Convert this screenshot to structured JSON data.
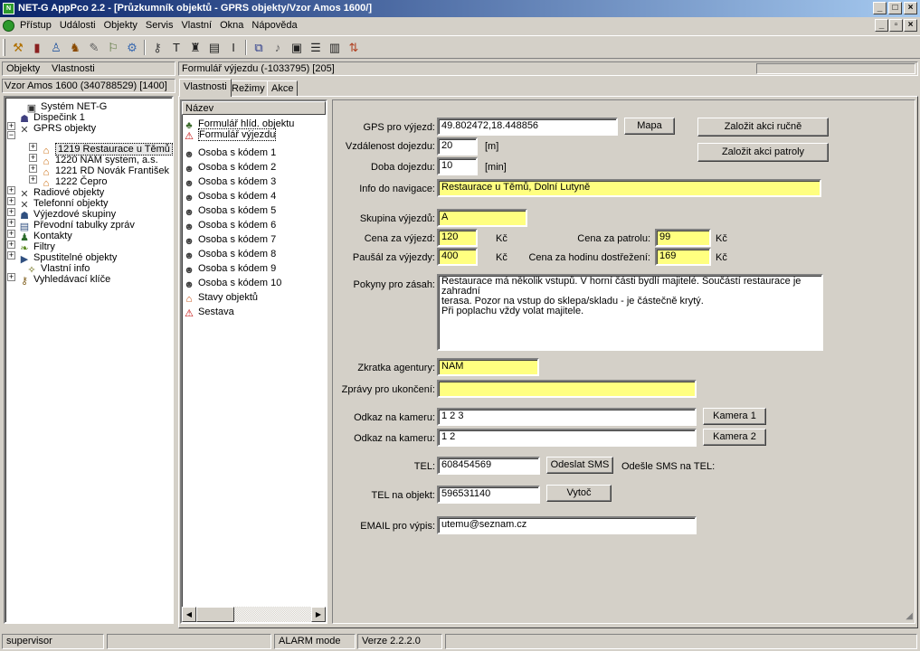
{
  "window": {
    "title": "NET-G AppPco 2.2 - [Průzkumník objektů - GPRS objekty/Vzor Amos 1600/]"
  },
  "menu": [
    "Přístup",
    "Události",
    "Objekty",
    "Servis",
    "Vlastní",
    "Okna",
    "Nápověda"
  ],
  "left_panel": {
    "tabs": [
      "Objekty",
      "Vlastnosti"
    ],
    "path": "Vzor Amos 1600  (340788529) [1400]",
    "tree": [
      {
        "label": "Systém NET-G",
        "icon": "computer-icon"
      },
      {
        "label": "Dispečink 1",
        "icon": "network-icon"
      },
      {
        "label": "GPRS objekty",
        "icon": "antenna-icon"
      },
      {
        "label": "1219 Restaurace u Těmů",
        "icon": "house-icon"
      },
      {
        "label": "1220 NAM system, a.s.",
        "icon": "house-icon"
      },
      {
        "label": "1221 RD Novák František",
        "icon": "house-icon"
      },
      {
        "label": "1222 Čepro",
        "icon": "house-icon"
      },
      {
        "label": "Radiové objekty",
        "icon": "antenna-icon"
      },
      {
        "label": "Telefonní objekty",
        "icon": "antenna-icon"
      },
      {
        "label": "Výjezdové skupiny",
        "icon": "car-icon"
      },
      {
        "label": "Převodní tabulky zpráv",
        "icon": "table-icon"
      },
      {
        "label": "Kontakty",
        "icon": "person-icon"
      },
      {
        "label": "Filtry",
        "icon": "filter-icon"
      },
      {
        "label": "Spustitelné objekty",
        "icon": "run-icon"
      },
      {
        "label": "Vlastní info",
        "icon": "info-icon"
      },
      {
        "label": "Vyhledávací klíče",
        "icon": "key-icon"
      }
    ]
  },
  "middle_panel": {
    "header": "Formulář výjezdu  (-1033795) [205]",
    "tabs": [
      "Vlastnosti",
      "Režimy",
      "Akce"
    ],
    "list_header": "Název",
    "items": [
      {
        "label": "Formulář hlíd. objektu",
        "icon": "form-icon"
      },
      {
        "label": "Formulář výjezdu",
        "icon": "alert-icon"
      },
      {
        "label": "Osoba s kódem 1",
        "icon": "persons-icon"
      },
      {
        "label": "Osoba s kódem 2",
        "icon": "persons-icon"
      },
      {
        "label": "Osoba s kódem 3",
        "icon": "persons-icon"
      },
      {
        "label": "Osoba s kódem 4",
        "icon": "persons-icon"
      },
      {
        "label": "Osoba s kódem 5",
        "icon": "persons-icon"
      },
      {
        "label": "Osoba s kódem 6",
        "icon": "persons-icon"
      },
      {
        "label": "Osoba s kódem 7",
        "icon": "persons-icon"
      },
      {
        "label": "Osoba s kódem 8",
        "icon": "persons-icon"
      },
      {
        "label": "Osoba s kódem 9",
        "icon": "persons-icon"
      },
      {
        "label": "Osoba s kódem 10",
        "icon": "persons-icon"
      },
      {
        "label": "Stavy objektů",
        "icon": "state-icon"
      },
      {
        "label": "Sestava",
        "icon": "alert-icon"
      }
    ]
  },
  "form": {
    "gps": {
      "label": "GPS pro výjezd:",
      "value": "49.802472,18.448856",
      "button": "Mapa"
    },
    "distance": {
      "label": "Vzdálenost dojezdu:",
      "value": "20",
      "unit": "[m]"
    },
    "time": {
      "label": "Doba dojezdu:",
      "value": "10",
      "unit": "[min]"
    },
    "nav": {
      "label": "Info do navigace:",
      "value": "Restaurace u Těmů, Dolní Lutyně"
    },
    "group": {
      "label": "Skupina výjezdů:",
      "value": "A"
    },
    "price_trip": {
      "label": "Cena za výjezd:",
      "value": "120",
      "unit": "Kč"
    },
    "price_patrol": {
      "label": "Cena za patrolu:",
      "value": "99",
      "unit": "Kč"
    },
    "flat_fee": {
      "label": "Paušál za výjezdy:",
      "value": "400",
      "unit": "Kč"
    },
    "price_hour": {
      "label": "Cena za hodinu dostřežení:",
      "value": "169",
      "unit": "Kč"
    },
    "instructions": {
      "label": "Pokyny pro zásah:",
      "lines": [
        "Restaurace má několik vstupů. V horní části bydlí majitelé. Součástí restaurace je zahradní",
        "terasa. Pozor na vstup do sklepa/skladu - je částečně krytý.",
        "Při poplachu vždy volat majitele."
      ]
    },
    "agency": {
      "label": "Zkratka agentury:",
      "value": "NAM"
    },
    "end_msgs": {
      "label": "Zprávy pro ukončení:",
      "value": ""
    },
    "camera1": {
      "label": "Odkaz na kameru:",
      "value": "1 2 3",
      "button": "Kamera 1"
    },
    "camera2": {
      "label": "Odkaz na kameru:",
      "value": "1 2",
      "button": "Kamera 2"
    },
    "tel": {
      "label": "TEL:",
      "value": "608454569",
      "button": "Odeslat SMS",
      "note": "Odešle SMS na TEL:"
    },
    "tel_obj": {
      "label": "TEL na objekt:",
      "value": "596531140",
      "button": "Vytoč"
    },
    "email": {
      "label": "EMAIL pro výpis:",
      "value": "utemu@seznam.cz"
    },
    "action_manual": "Založit akci ručně",
    "action_patrol": "Založit akci patroly"
  },
  "status": {
    "user": "supervisor",
    "mode": "ALARM mode",
    "version": "Verze 2.2.2.0"
  }
}
